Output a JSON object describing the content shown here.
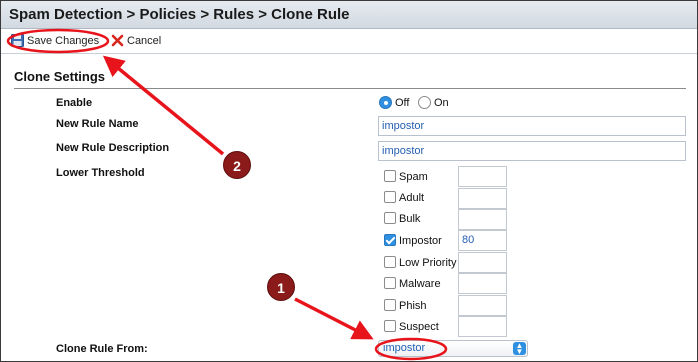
{
  "breadcrumb": "Spam Detection > Policies > Rules > Clone Rule",
  "toolbar": {
    "save_label": "Save Changes",
    "cancel_label": "Cancel"
  },
  "section_title": "Clone Settings",
  "labels": {
    "enable": "Enable",
    "new_rule_name": "New Rule Name",
    "new_rule_description": "New Rule Description",
    "lower_threshold": "Lower Threshold",
    "clone_rule_from": "Clone Rule From:"
  },
  "enable": {
    "off_label": "Off",
    "on_label": "On",
    "selected": "Off"
  },
  "fields": {
    "new_rule_name": "impostor",
    "new_rule_description": "impostor"
  },
  "thresholds": [
    {
      "label": "Spam",
      "checked": false,
      "value": ""
    },
    {
      "label": "Adult",
      "checked": false,
      "value": ""
    },
    {
      "label": "Bulk",
      "checked": false,
      "value": ""
    },
    {
      "label": "Impostor",
      "checked": true,
      "value": "80"
    },
    {
      "label": "Low Priority",
      "checked": false,
      "value": ""
    },
    {
      "label": "Malware",
      "checked": false,
      "value": ""
    },
    {
      "label": "Phish",
      "checked": false,
      "value": ""
    },
    {
      "label": "Suspect",
      "checked": false,
      "value": ""
    }
  ],
  "clone_from": {
    "selected": "impostor"
  },
  "callouts": [
    "1",
    "2"
  ],
  "colors": {
    "annotation": "#e8141c",
    "badge": "#8b1a1a",
    "accent": "#2f8fe0"
  }
}
